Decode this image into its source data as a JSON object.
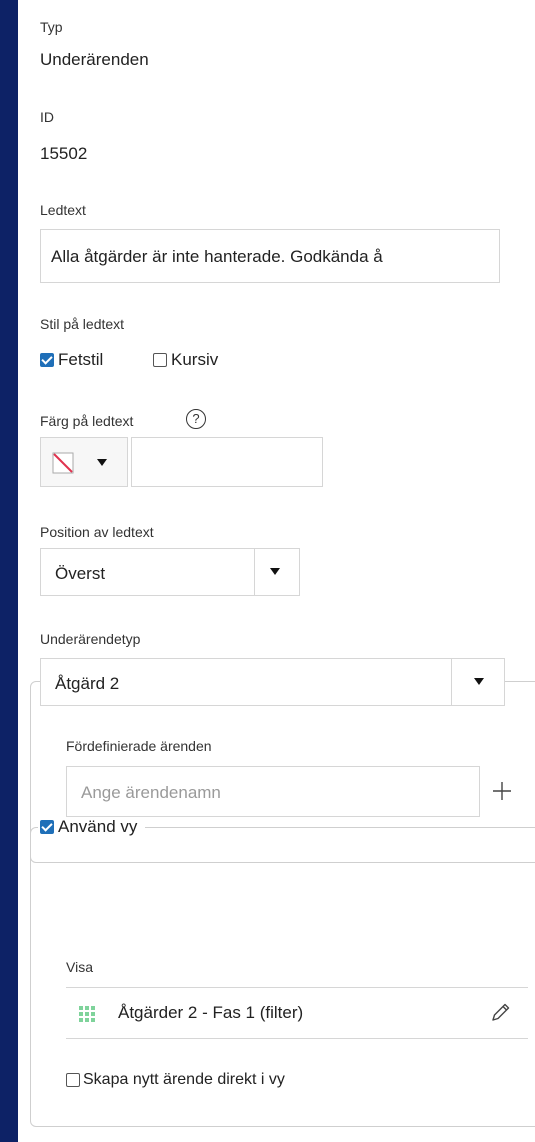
{
  "type_field": {
    "label": "Typ",
    "value": "Underärenden"
  },
  "id_field": {
    "label": "ID",
    "value": "15502"
  },
  "ledtext": {
    "label": "Ledtext",
    "value": "Alla åtgärder är inte hanterade. Godkända å"
  },
  "stil": {
    "label": "Stil på ledtext",
    "bold": {
      "label": "Fetstil",
      "checked": true
    },
    "italic": {
      "label": "Kursiv",
      "checked": false
    }
  },
  "farg": {
    "label": "Färg på ledtext",
    "help_icon": "?",
    "swatch_icon": "no-color-icon",
    "value": ""
  },
  "position": {
    "label": "Position av ledtext",
    "selected": "Överst"
  },
  "underarendetyp": {
    "label": "Underärendetyp",
    "selected": "Åtgärd 2",
    "predefined_label": "Fördefinierade ärenden",
    "predefined_placeholder": "Ange ärendenamn",
    "add_icon": "plus-icon"
  },
  "vy": {
    "checkbox_label": "Använd vy",
    "checked": true,
    "visa_label": "Visa",
    "view_name": "Åtgärder 2 - Fas 1 (filter)",
    "view_icon": "grid-icon",
    "edit_icon": "pencil-icon",
    "create_direct": {
      "label": "Skapa nytt ärende direkt i vy",
      "checked": false
    }
  },
  "colors": {
    "background": "#0d2266",
    "accent": "#1f6fb8",
    "no_color_line": "#e0344f",
    "grid_icon": "#7fd39b"
  }
}
